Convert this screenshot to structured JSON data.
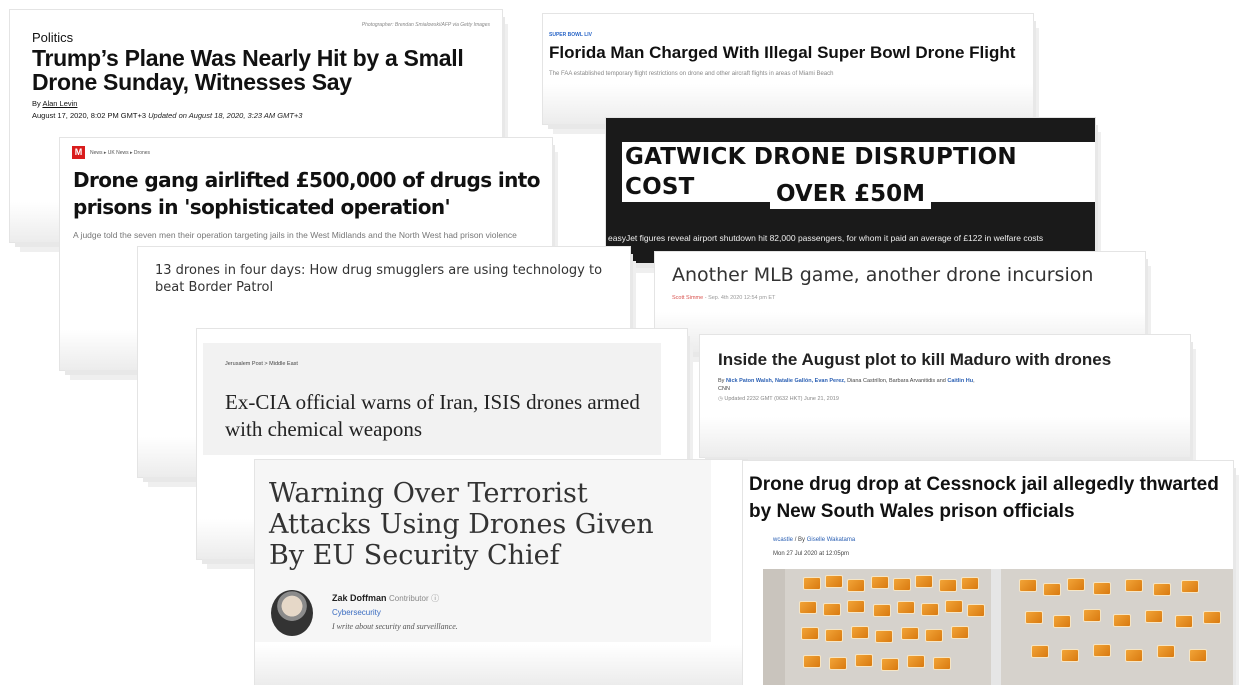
{
  "articles": [
    {
      "category": "Politics",
      "photo_credit": "Photographer: Brendan Smialowski/AFP via Getty Images",
      "headline": "Trump’s Plane Was Nearly Hit by a Small Drone Sunday, Witnesses Say",
      "by_prefix": "By",
      "author": "Alan Levin",
      "date": "August 17, 2020, 8:02 PM GMT+3",
      "updated": "Updated on August 18, 2020, 3:23 AM GMT+3"
    },
    {
      "kicker": "SUPER BOWL LIV",
      "headline": "Florida Man Charged With Illegal Super Bowl Drone Flight",
      "subhead": "The FAA established temporary flight restrictions on drone and other aircraft flights in areas of Miami Beach"
    },
    {
      "logo": "M",
      "breadcrumb": "News  ▸  UK News  ▸  Drones",
      "headline": "Drone gang airlifted £500,000 of drugs into prisons in 'sophisticated operation'",
      "subhead": "A judge told the seven men their operation targeting jails in the West Midlands and the North West had prison violence"
    },
    {
      "headline_line1": "GATWICK DRONE DISRUPTION COST",
      "headline_line2": "OVER £50M",
      "subhead": "easyJet figures reveal airport shutdown hit 82,000 passengers, for whom it paid an average of £122 in welfare costs"
    },
    {
      "headline": "13 drones in four days: How drug smugglers are using technology to beat Border Patrol"
    },
    {
      "headline": "Another MLB game, another drone incursion",
      "author": "Scott Simme",
      "date": " - Sep. 4th 2020 12:54 pm ET"
    },
    {
      "breadcrumb": "Jerusalem Post  >  Middle East",
      "headline": "Ex-CIA official warns of Iran, ISIS drones armed with chemical weapons"
    },
    {
      "headline": "Inside the August plot to kill Maduro with drones",
      "by_prefix": "By",
      "authors_linked": "Nick Paton Walsh, Natalie Gallón, Evan Perez,",
      "authors_plain": " Diana Castrillon, Barbara Arvanitidis and ",
      "authors_linked2": "Caitlin Hu",
      "outlet": ", CNN",
      "updated": "Updated 2232 GMT (0632 HKT) June 21, 2019"
    },
    {
      "headline": "Warning Over Terrorist Attacks Using Drones Given By EU Security Chief",
      "author": "Zak Doffman",
      "role": "Contributor",
      "section": "Cybersecurity",
      "about": "I write about security and surveillance."
    },
    {
      "headline": "Drone drug drop at Cessnock jail allegedly thwarted by New South Wales prison officials",
      "byline_place": "wcastle",
      "byline_author": "Giselle Wakatama",
      "date": "Mon 27 Jul 2020 at 12:05pm"
    }
  ],
  "colors": {
    "link_blue": "#2a5fb3",
    "gatwick_bg": "#1a1a1a",
    "mirror_red": "#d91c1c",
    "orange_bags": "#f2a437"
  }
}
